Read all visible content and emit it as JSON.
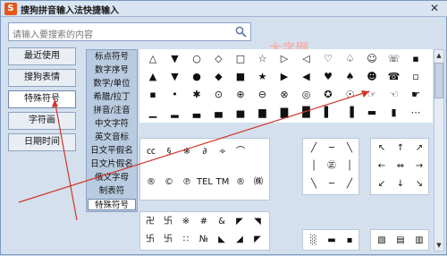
{
  "window": {
    "title": "搜狗拼音输入法快捷输入",
    "app_letter": "S",
    "close": "✕"
  },
  "search": {
    "placeholder": "请输入要搜索的内容"
  },
  "watermark": "大字网",
  "left_buttons": [
    "最近使用",
    "搜狗表情",
    "特殊符号",
    "字符画",
    "日期时间"
  ],
  "categories": [
    "标点符号",
    "数字序号",
    "数学/单位",
    "希腊/拉丁",
    "拼音/注音",
    "中文字符",
    "英文音标",
    "日文平假名",
    "日文片假名",
    "俄文字母",
    "制表符",
    "特殊符号"
  ],
  "grid_rows": [
    [
      "△",
      "▼",
      "○",
      "◇",
      "□",
      "☆",
      "▷",
      "◁",
      "♡",
      "♤",
      "☺",
      "☏",
      "▪"
    ],
    [
      "▲",
      "▼",
      "●",
      "◆",
      "■",
      "★",
      "▶",
      "◀",
      "♥",
      "♠",
      "☻",
      "☎",
      "▫"
    ],
    [
      "▪",
      "•",
      "✱",
      "⊙",
      "⊕",
      "⊖",
      "⊗",
      "◎",
      "✪",
      "☉",
      "☞",
      "☜",
      "☛"
    ],
    [
      "▁",
      "▂",
      "▃",
      "▄",
      "▅",
      "▆",
      "▇",
      "█",
      "▌",
      "▐",
      "▬",
      "▮",
      "⋯"
    ]
  ],
  "group_a": [
    [
      "㏄",
      "§",
      "※",
      "∂",
      "÷",
      "⌒"
    ],
    [
      "®",
      "©",
      "℗",
      "TEL",
      "TM",
      "®",
      "㈱"
    ]
  ],
  "group_b": [
    [
      "╱",
      "─",
      "╲"
    ],
    [
      "│",
      "㊣",
      "│"
    ],
    [
      "╲",
      "─",
      "╱"
    ]
  ],
  "group_c": [
    [
      "↖",
      "↑",
      "↗"
    ],
    [
      "←",
      "⇔",
      "→"
    ],
    [
      "↙",
      "↓",
      "↘"
    ]
  ],
  "group_d": [
    [
      "卍",
      "卐",
      "※",
      "#",
      "&",
      "◤",
      "◥"
    ],
    [
      "卐",
      "卐",
      "∷",
      "№",
      "◣",
      "◢",
      "◤"
    ]
  ],
  "group_e": [
    "░",
    "▬",
    "▪"
  ],
  "group_f": [
    "▧",
    "▤",
    "▥"
  ]
}
